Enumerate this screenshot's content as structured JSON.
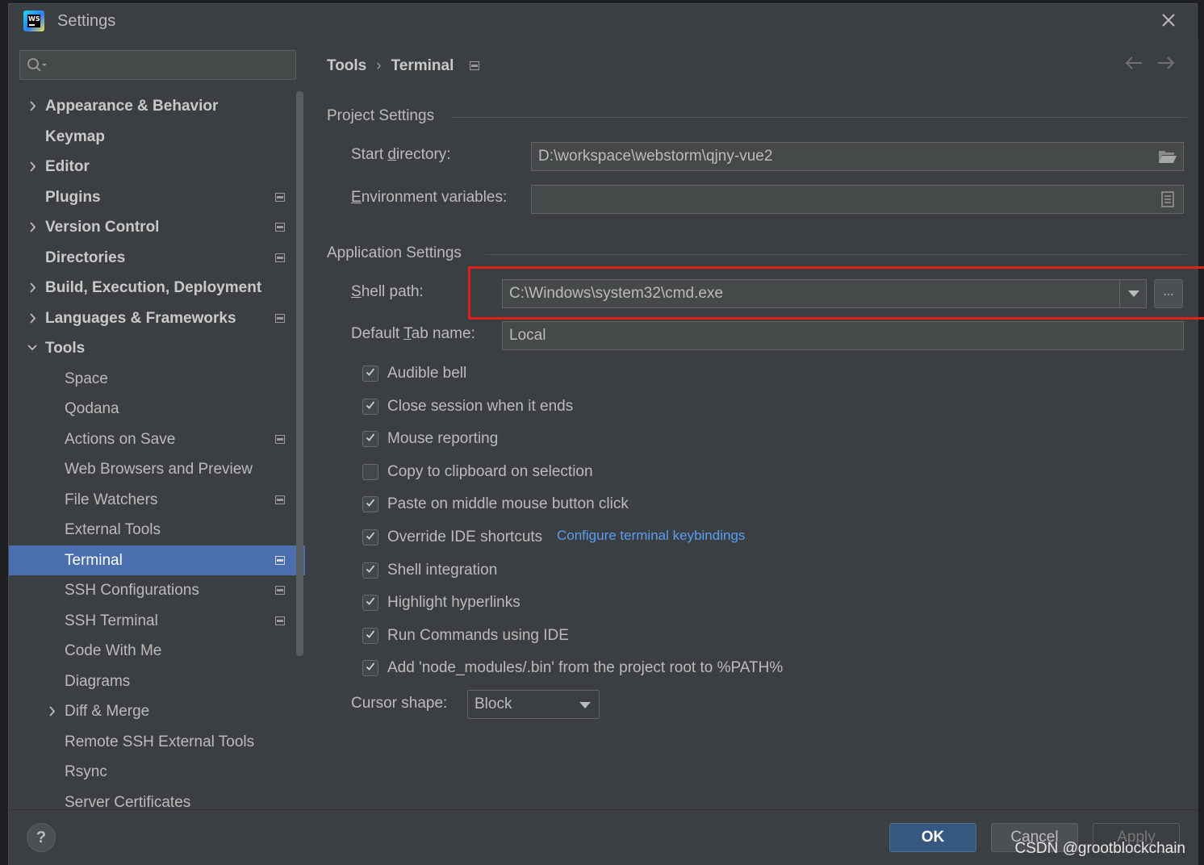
{
  "window": {
    "title": "Settings"
  },
  "search": {
    "placeholder": ""
  },
  "sidebar": {
    "items": [
      {
        "label": "Appearance & Behavior",
        "bold": true,
        "expand": "collapsed",
        "level": 0,
        "project_icon": false
      },
      {
        "label": "Keymap",
        "bold": true,
        "expand": "none",
        "level": 0,
        "project_icon": false
      },
      {
        "label": "Editor",
        "bold": true,
        "expand": "collapsed",
        "level": 0,
        "project_icon": false
      },
      {
        "label": "Plugins",
        "bold": true,
        "expand": "none",
        "level": 0,
        "project_icon": true
      },
      {
        "label": "Version Control",
        "bold": true,
        "expand": "collapsed",
        "level": 0,
        "project_icon": true
      },
      {
        "label": "Directories",
        "bold": true,
        "expand": "none",
        "level": 0,
        "project_icon": true
      },
      {
        "label": "Build, Execution, Deployment",
        "bold": true,
        "expand": "collapsed",
        "level": 0,
        "project_icon": false
      },
      {
        "label": "Languages & Frameworks",
        "bold": true,
        "expand": "collapsed",
        "level": 0,
        "project_icon": true
      },
      {
        "label": "Tools",
        "bold": true,
        "expand": "expanded",
        "level": 0,
        "project_icon": false
      },
      {
        "label": "Space",
        "bold": false,
        "expand": "none",
        "level": 1,
        "project_icon": false
      },
      {
        "label": "Qodana",
        "bold": false,
        "expand": "none",
        "level": 1,
        "project_icon": false
      },
      {
        "label": "Actions on Save",
        "bold": false,
        "expand": "none",
        "level": 1,
        "project_icon": true
      },
      {
        "label": "Web Browsers and Preview",
        "bold": false,
        "expand": "none",
        "level": 1,
        "project_icon": false
      },
      {
        "label": "File Watchers",
        "bold": false,
        "expand": "none",
        "level": 1,
        "project_icon": true
      },
      {
        "label": "External Tools",
        "bold": false,
        "expand": "none",
        "level": 1,
        "project_icon": false
      },
      {
        "label": "Terminal",
        "bold": false,
        "expand": "none",
        "level": 1,
        "project_icon": true,
        "selected": true
      },
      {
        "label": "SSH Configurations",
        "bold": false,
        "expand": "none",
        "level": 1,
        "project_icon": true
      },
      {
        "label": "SSH Terminal",
        "bold": false,
        "expand": "none",
        "level": 1,
        "project_icon": true
      },
      {
        "label": "Code With Me",
        "bold": false,
        "expand": "none",
        "level": 1,
        "project_icon": false
      },
      {
        "label": "Diagrams",
        "bold": false,
        "expand": "none",
        "level": 1,
        "project_icon": false
      },
      {
        "label": "Diff & Merge",
        "bold": false,
        "expand": "collapsed",
        "level": 1,
        "project_icon": false
      },
      {
        "label": "Remote SSH External Tools",
        "bold": false,
        "expand": "none",
        "level": 1,
        "project_icon": false
      },
      {
        "label": "Rsync",
        "bold": false,
        "expand": "none",
        "level": 1,
        "project_icon": false
      },
      {
        "label": "Server Certificates",
        "bold": false,
        "expand": "none",
        "level": 1,
        "project_icon": false
      }
    ]
  },
  "breadcrumb": {
    "parent": "Tools",
    "separator": "›",
    "current": "Terminal"
  },
  "project_settings": {
    "title": "Project Settings",
    "start_directory": {
      "label_pre": "Start ",
      "label_mn": "d",
      "label_post": "irectory:",
      "value": "D:\\workspace\\webstorm\\qjny-vue2"
    },
    "env_vars": {
      "label_pre": "",
      "label_mn": "E",
      "label_post": "nvironment variables:",
      "value": ""
    }
  },
  "app_settings": {
    "title": "Application Settings",
    "shell_path": {
      "label_pre": "",
      "label_mn": "S",
      "label_post": "hell path:",
      "value": "C:\\Windows\\system32\\cmd.exe",
      "browse_label": "..."
    },
    "default_tab": {
      "label_pre": "Default ",
      "label_mn": "T",
      "label_post": "ab name:",
      "value": "Local"
    },
    "checkboxes": [
      {
        "label": "Audible bell",
        "checked": true
      },
      {
        "label": "Close session when it ends",
        "checked": true
      },
      {
        "label": "Mouse reporting",
        "checked": true
      },
      {
        "label": "Copy to clipboard on selection",
        "checked": false
      },
      {
        "label": "Paste on middle mouse button click",
        "checked": true
      },
      {
        "label": "Override IDE shortcuts",
        "checked": true
      },
      {
        "label": "Shell integration",
        "checked": true
      },
      {
        "label": "Highlight hyperlinks",
        "checked": true
      },
      {
        "label": "Run Commands using IDE",
        "checked": true
      },
      {
        "label": "Add 'node_modules/.bin' from the project root to %PATH%",
        "checked": true
      }
    ],
    "keybindings_link": "Configure terminal keybindings",
    "cursor_shape": {
      "label": "Cursor shape:",
      "value": "Block"
    }
  },
  "footer": {
    "help_label": "?",
    "ok_label": "OK",
    "cancel_label": "Cancel",
    "apply_label": "Apply",
    "watermark": "CSDN @grootblockchain"
  },
  "colors": {
    "background": "#3c3f41",
    "selection": "#4b6eaf",
    "link": "#589df6",
    "highlight_box": "#e0201b",
    "ok_button": "#365880"
  }
}
